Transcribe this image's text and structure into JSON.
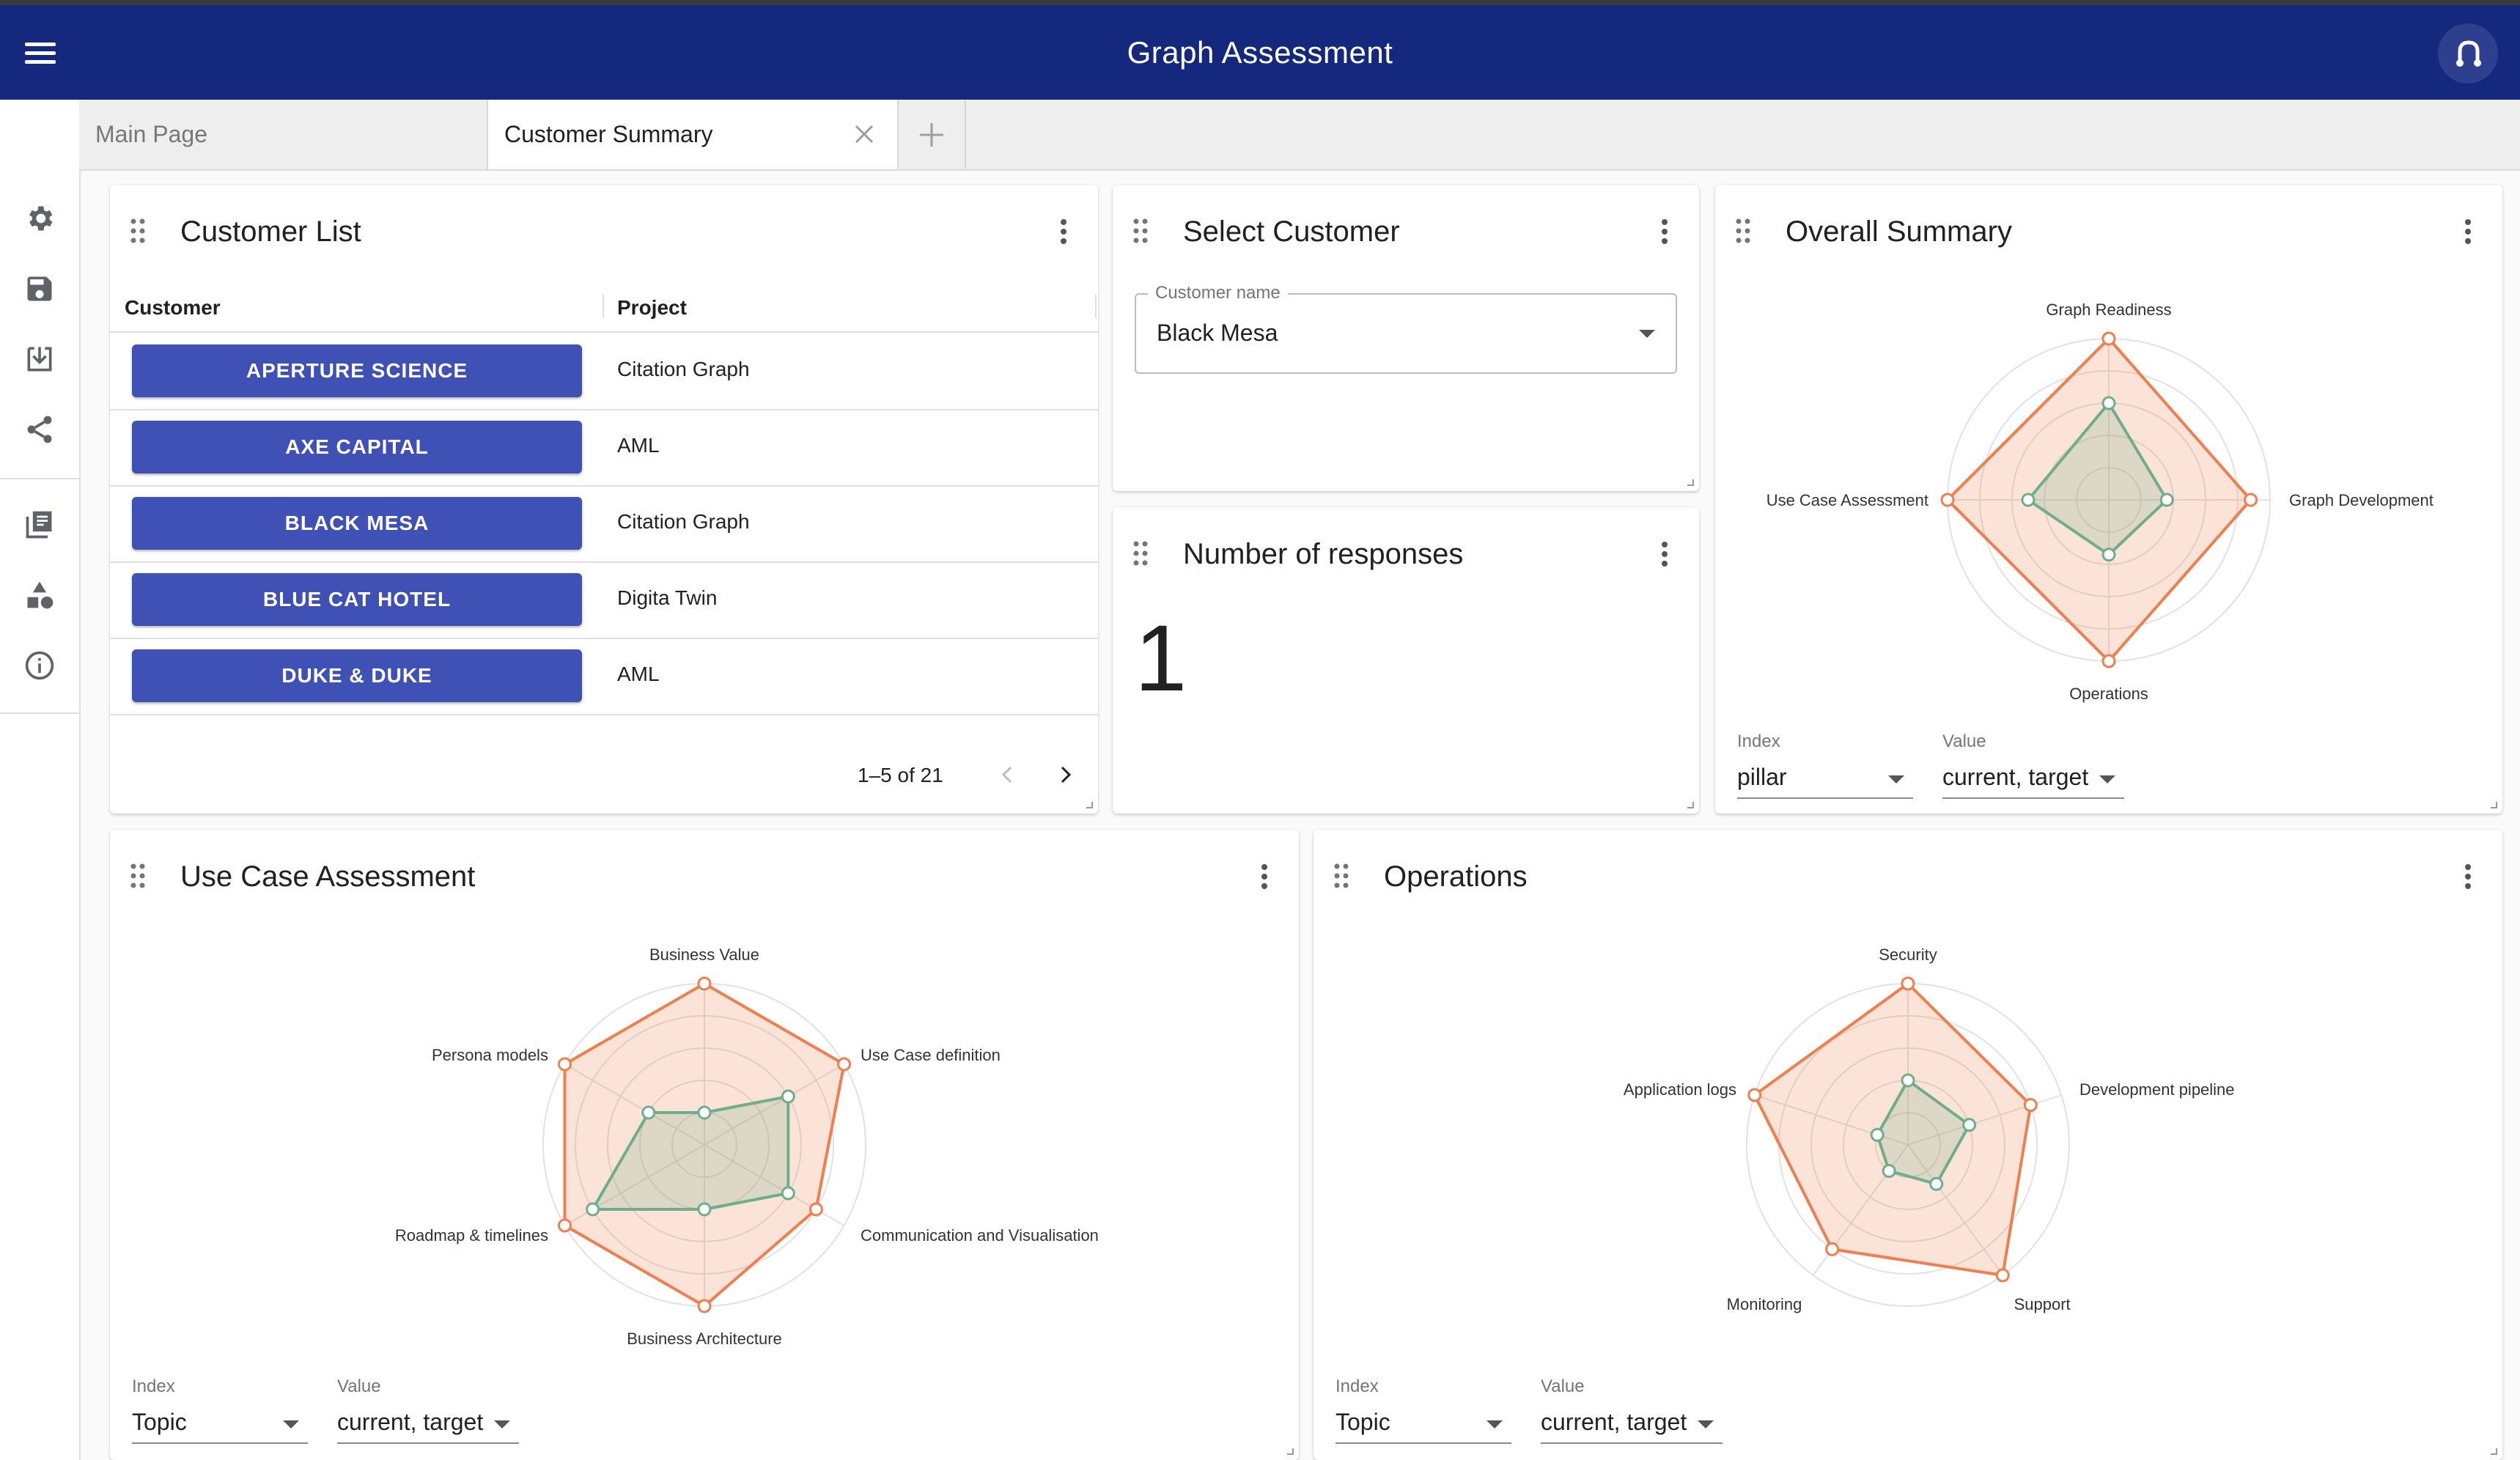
{
  "app": {
    "title": "Graph Assessment"
  },
  "tabs": [
    {
      "label": "Main Page"
    },
    {
      "label": "Customer Summary"
    }
  ],
  "sidebar_icons": [
    "gear-icon",
    "save-icon",
    "download-icon",
    "share-icon",
    "library-icon",
    "shapes-icon",
    "info-icon"
  ],
  "customer_list": {
    "title": "Customer List",
    "col_customer": "Customer",
    "col_project": "Project",
    "rows": [
      {
        "customer": "APERTURE SCIENCE",
        "project": "Citation Graph"
      },
      {
        "customer": "AXE CAPITAL",
        "project": "AML"
      },
      {
        "customer": "BLACK MESA",
        "project": "Citation Graph"
      },
      {
        "customer": "BLUE CAT HOTEL",
        "project": "Digita Twin"
      },
      {
        "customer": "DUKE & DUKE",
        "project": "AML"
      }
    ],
    "pagination": "1–5 of 21"
  },
  "select_customer": {
    "title": "Select Customer",
    "label": "Customer name",
    "value": "Black Mesa"
  },
  "responses": {
    "title": "Number of responses",
    "value": "1"
  },
  "overall": {
    "title": "Overall Summary",
    "index_label": "Index",
    "index_value": "pillar",
    "value_label": "Value",
    "value_value": "current, target"
  },
  "usecase": {
    "title": "Use Case Assessment",
    "index_label": "Index",
    "index_value": "Topic",
    "value_label": "Value",
    "value_value": "current, target"
  },
  "operations": {
    "title": "Operations",
    "index_label": "Index",
    "index_value": "Topic",
    "value_label": "Value",
    "value_value": "current, target"
  },
  "chart_data": [
    {
      "type": "radar",
      "id": "overall",
      "axes": [
        "Graph Readiness",
        "Graph Development",
        "Operations",
        "Use Case Assessment"
      ],
      "series": [
        {
          "name": "target",
          "values": [
            5,
            4.4,
            5,
            5
          ],
          "color": "#ee7f4f"
        },
        {
          "name": "current",
          "values": [
            3,
            1.8,
            1.7,
            2.5
          ],
          "color": "#6fae8b"
        }
      ],
      "max": 5
    },
    {
      "type": "radar",
      "id": "usecase",
      "axes": [
        "Business Value",
        "Use Case definition",
        "Communication and Visualisation",
        "Business Architecture",
        "Roadmap & timelines",
        "Persona models"
      ],
      "series": [
        {
          "name": "target",
          "values": [
            5,
            5,
            4,
            5,
            5,
            5
          ],
          "color": "#ee7f4f"
        },
        {
          "name": "current",
          "values": [
            1,
            3,
            3,
            2,
            4,
            2
          ],
          "color": "#6fae8b"
        }
      ],
      "max": 5
    },
    {
      "type": "radar",
      "id": "operations",
      "axes": [
        "Security",
        "Development pipeline",
        "Support",
        "Monitoring",
        "Application logs"
      ],
      "series": [
        {
          "name": "target",
          "values": [
            5,
            4,
            5,
            4,
            5
          ],
          "color": "#ee7f4f"
        },
        {
          "name": "current",
          "values": [
            2,
            2,
            1.5,
            1,
            1
          ],
          "color": "#6fae8b"
        }
      ],
      "max": 5
    }
  ]
}
